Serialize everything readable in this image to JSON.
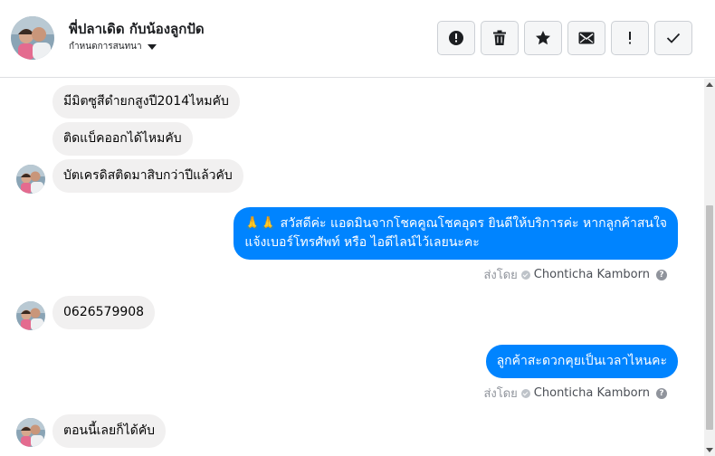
{
  "header": {
    "name": "พี่ปลาเดิด กับน้องลูกปัด",
    "subtitle": "กำหนดการสนทนา",
    "actions": [
      "report",
      "delete",
      "star",
      "mail",
      "important",
      "done"
    ]
  },
  "messages": {
    "in1": "มีมิตซูสีดำยกสูงปี2014ไหมคับ",
    "in2": "ติดแบ็คออกได้ไหมคับ",
    "in3": "บัตเครดิสติดมาสิบกว่าปีแล้วคับ",
    "out1_line1": "🙏🙏 สวัสดีค่ะ แอดมินจากโชคคูณโชคอุดร ยินดีให้บริการค่ะ หากลูกค้าสนใจ",
    "out1_line2": "แจ้งเบอร์โทรศัพท์ หรือ ไอดีไลน์ไว้เลยนะคะ",
    "in4": "0626579908",
    "out2": "ลูกค้าสะดวกคุยเป็นเวลาไหนคะ",
    "in5": "ตอนนี้เลยก็ได้คับ"
  },
  "sent_by": {
    "label": "ส่งโดย",
    "agent": "Chonticha Kamborn"
  },
  "colors": {
    "outgoing_bubble": "#0084ff",
    "incoming_bubble": "#f1f0f0"
  }
}
